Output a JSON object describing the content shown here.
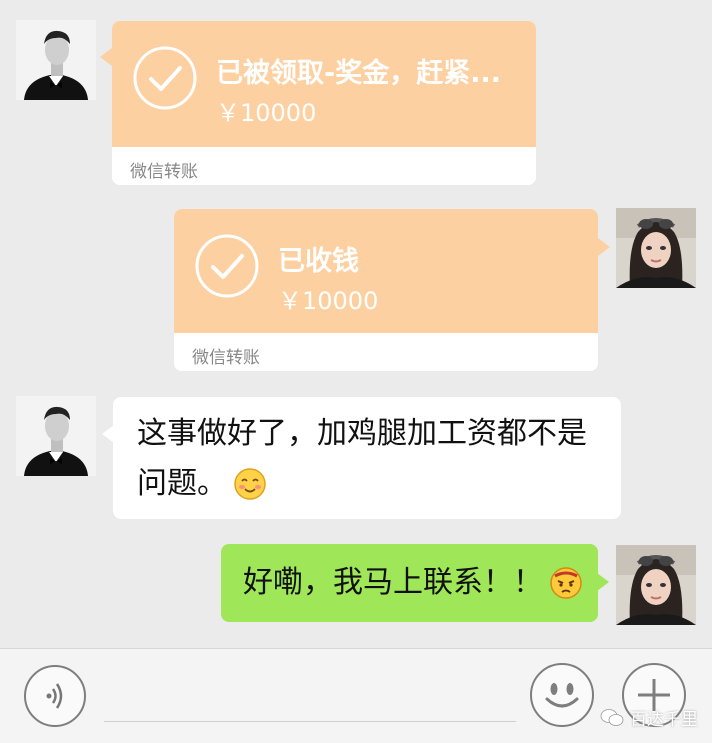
{
  "messages": {
    "m1": {
      "title": "已被领取-奖金，赶紧...",
      "amount": "￥10000",
      "footer": "微信转账"
    },
    "m2": {
      "title": "已收钱",
      "amount": "￥10000",
      "footer": "微信转账"
    },
    "m3": {
      "line1": "这事做好了，加鸡腿加工资都不是",
      "line2": "问题。"
    },
    "m4": {
      "text": "好嘞，我马上联系！！"
    }
  },
  "watermark": "百达千里",
  "colors": {
    "transfer": "#fdd0a1",
    "sent_bubble": "#9fe658",
    "received_bubble": "#ffffff",
    "background": "#ebebeb"
  },
  "icons": [
    "check-icon",
    "smile-emoji-icon",
    "angry-emoji-icon",
    "voice-icon",
    "emoji-icon",
    "add-icon",
    "wechat-icon"
  ]
}
